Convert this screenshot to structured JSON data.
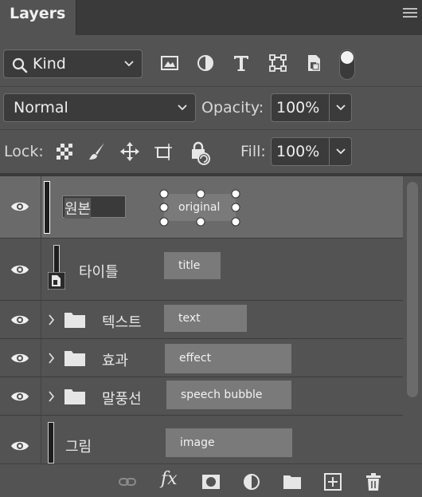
{
  "panel": {
    "title": "Layers",
    "menu_icon": "panel-menu-icon"
  },
  "filter": {
    "kind_label": "Kind",
    "icons": [
      "image-filter-icon",
      "adjustment-filter-icon",
      "type-filter-icon",
      "shape-filter-icon",
      "smart-object-filter-icon"
    ]
  },
  "blend": {
    "mode": "Normal",
    "opacity_label": "Opacity:",
    "opacity_value": "100%"
  },
  "lock": {
    "label": "Lock:",
    "fill_label": "Fill:",
    "fill_value": "100%",
    "icons": [
      "lock-transparent-pixels-icon",
      "lock-image-pixels-icon",
      "lock-position-icon",
      "lock-artboard-icon",
      "lock-all-icon"
    ]
  },
  "layers": [
    {
      "name": "원본",
      "note": "original",
      "type": "pixel",
      "selected": true,
      "editing": true
    },
    {
      "name": "타이틀",
      "note": "title",
      "type": "smart"
    },
    {
      "name": "텍스트",
      "note": "text",
      "type": "group"
    },
    {
      "name": "효과",
      "note": "effect",
      "type": "group"
    },
    {
      "name": "말풍선",
      "note": "speech bubble",
      "type": "group"
    },
    {
      "name": "그림",
      "note": "image",
      "type": "pixel"
    }
  ],
  "bottom_bar": {
    "icons": [
      "link-layers-icon",
      "fx-icon",
      "add-mask-icon",
      "new-adjustment-icon",
      "new-group-icon",
      "new-layer-icon",
      "delete-layer-icon"
    ],
    "fx_label": "fx"
  },
  "colors": {
    "panel_bg": "#535353",
    "selected_row": "#6a6a6a",
    "note_bg": "#7a7a7a"
  }
}
